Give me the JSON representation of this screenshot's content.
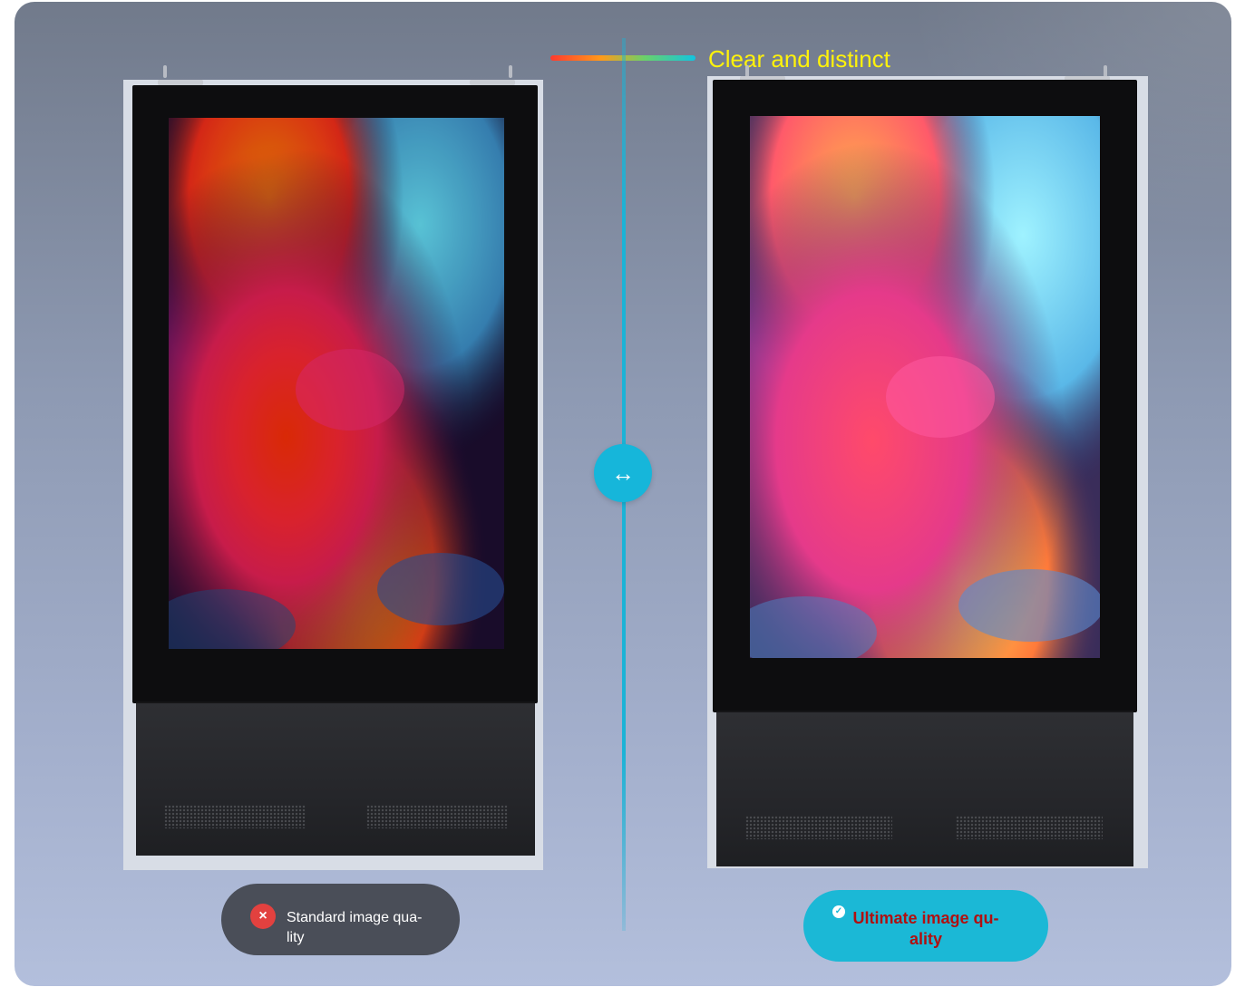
{
  "headline": {
    "text": "Clear and distinct"
  },
  "compare": {
    "handle_glyph": "↔"
  },
  "left": {
    "badge_label": "Standard image qua-\nlity",
    "badge_icon": "close-icon"
  },
  "right": {
    "badge_label": "Ultimate image qu-\nality",
    "badge_icon": "check-icon"
  },
  "colors": {
    "accent_cyan": "#1bb8d6",
    "headline_yellow": "#fff20a",
    "error_red": "#e2413f",
    "ultimate_text": "#b01010"
  }
}
